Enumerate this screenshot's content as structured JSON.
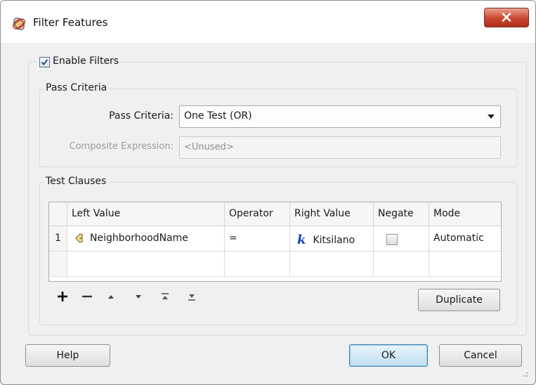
{
  "window": {
    "title": "Filter Features",
    "close_glyph": "✕"
  },
  "enable_filters": {
    "label": "Enable Filters",
    "checked": true,
    "check_glyph": "✔"
  },
  "pass_criteria": {
    "group_label": "Pass Criteria",
    "field_label": "Pass Criteria:",
    "selected": "One Test (OR)",
    "composite_label": "Composite Expression:",
    "composite_value": "<Unused>"
  },
  "test_clauses": {
    "group_label": "Test Clauses",
    "columns": [
      "Left Value",
      "Operator",
      "Right Value",
      "Negate",
      "Mode"
    ],
    "rows": [
      {
        "num": "1",
        "left_value": "NeighborhoodName",
        "left_icon": "attribute-tag-icon",
        "operator": "=",
        "right_value": "Kitsilano",
        "right_icon": "constant-k-icon",
        "right_glyph": "k",
        "negate": false,
        "mode": "Automatic"
      }
    ],
    "tools": {
      "add": "+",
      "remove": "—"
    },
    "duplicate_label": "Duplicate"
  },
  "buttons": {
    "help": "Help",
    "ok": "OK",
    "cancel": "Cancel"
  },
  "colors": {
    "dialog_bg": "#f0f0f0",
    "close_red": "#c8452f",
    "ok_blue": "#c1dff4",
    "k_blue": "#1d3fb8",
    "tag_gold": "#c9a227"
  }
}
